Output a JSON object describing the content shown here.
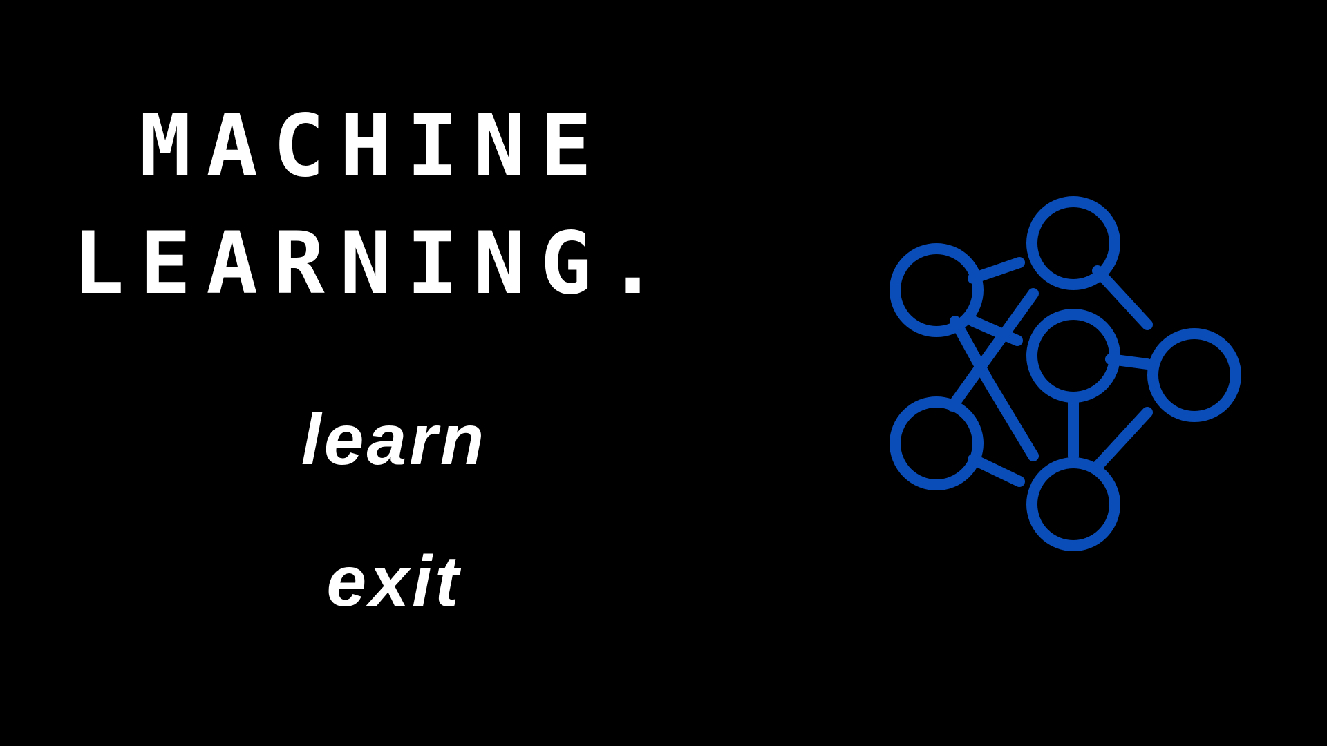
{
  "title": {
    "line1": "MACHINE",
    "line2": "LEARNING."
  },
  "menu": {
    "learn_label": "learn",
    "exit_label": "exit"
  },
  "icon": {
    "name": "neural-network-icon",
    "color": "#0a4db8"
  },
  "colors": {
    "background": "#000000",
    "text": "#ffffff",
    "accent": "#0a4db8"
  }
}
